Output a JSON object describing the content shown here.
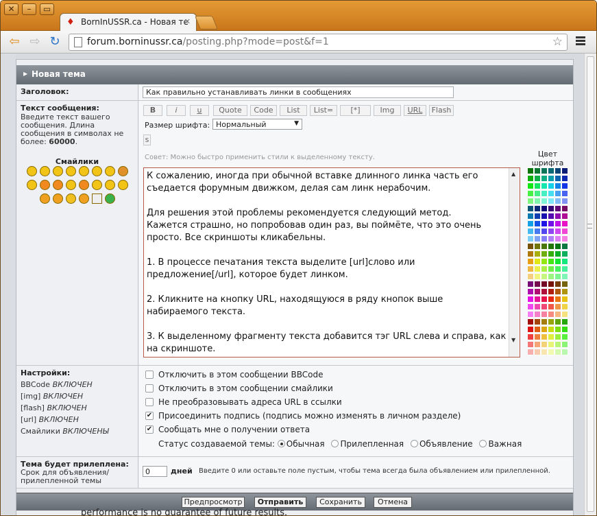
{
  "browser": {
    "tab_title": "BornInUSSR.ca - Новая те",
    "url_host": "forum.borninussr.ca",
    "url_path": "/posting.php?mode=post&f=1",
    "window_close": "✕",
    "window_minimize": "–",
    "window_maximize": "▭"
  },
  "form": {
    "header": "Новая тема",
    "subject_label": "Заголовок:",
    "subject_value": "Как правильно устанавливать линки в сообщениях",
    "message_label": "Текст сообщения:",
    "message_help": "Введите текст вашего сообщения. Длина сообщения в символах не более:",
    "message_limit": "60000",
    "smilies_label": "Смайлики",
    "bbcode_buttons": [
      "B",
      "i",
      "u",
      "Quote",
      "Code",
      "List",
      "List=",
      "[*]",
      "Img",
      "URL",
      "Flash"
    ],
    "s_button": "s",
    "font_size_label": "Размер шрифта:",
    "font_size_value": "Нормальный",
    "hint": "Совет: Можно быстро применить стили к выделенному тексту.",
    "color_label_1": "Цвет",
    "color_label_2": "шрифта",
    "message_text": "К сожалению, иногда при обычной вставке длинного линка часть его съедается форумным движком, делая сам линк нерабочим.\n\nДля решения этой проблемы рекомендуется следующий метод.\nКажется страшно, но попробовав один раз, вы поймёте, что это очень просто. Все скриншоты кликабельны.\n\n1. В процессе печатания текста выделите [url]слово или предложение[/url], которое будет линком.\n\n2. Кликните на кнопку URL, находящуюся в ряду кнопок выше набираемого текста.\n\n3. К выделенному фрагменту текста добавится тэг URL слева и справа, как на скриншоте."
  },
  "settings": {
    "label": "Настройки:",
    "status_lines": [
      {
        "name": "BBCode",
        "state": "ВКЛЮЧЕН"
      },
      {
        "name": "[img]",
        "state": "ВКЛЮЧЕН"
      },
      {
        "name": "[flash]",
        "state": "ВКЛЮЧЕН"
      },
      {
        "name": "[url]",
        "state": "ВКЛЮЧЕН"
      },
      {
        "name": "Смайлики",
        "state": "ВКЛЮЧЕНЫ"
      }
    ],
    "options": [
      {
        "label": "Отключить в этом сообщении BBCode",
        "checked": false
      },
      {
        "label": "Отключить в этом сообщении смайлики",
        "checked": false
      },
      {
        "label": "Не преобразовывать адреса URL в ссылки",
        "checked": false
      },
      {
        "label": "Присоединить подпись (подпись можно изменять в личном разделе)",
        "checked": true
      },
      {
        "label": "Сообщать мне о получении ответа",
        "checked": true
      }
    ],
    "topic_status_label": "Статус создаваемой темы:",
    "topic_types": [
      "Обычная",
      "Прилепленная",
      "Объявление",
      "Важная"
    ],
    "topic_selected": "Обычная"
  },
  "sticky": {
    "label": "Тема будет прилеплена:",
    "help": "Срок для объявления/ прилепленной темы",
    "days_value": "0",
    "days_unit": "дней",
    "days_help": "Введите 0 или оставьте поле пустым, чтобы тема всегда была объявлением или прилепленной."
  },
  "buttons": {
    "preview": "Предпросмотр",
    "submit": "Отправить",
    "save": "Сохранить",
    "cancel": "Отмена"
  },
  "below_text": "performance is no guarantee of future results."
}
